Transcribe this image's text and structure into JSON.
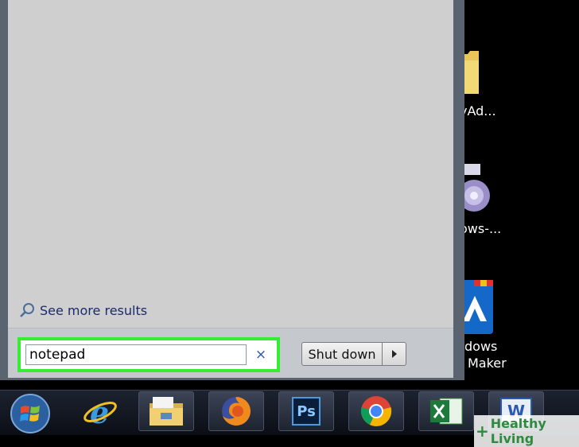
{
  "start_menu": {
    "see_more": "See more results",
    "search": {
      "value": "notepad",
      "clear": "×"
    },
    "shutdown": {
      "label": "Shut down"
    }
  },
  "desktop": {
    "icons": [
      {
        "name": "folder-shortcut",
        "label": "yAd..."
      },
      {
        "name": "disc-shortcut",
        "label": "ows-..."
      },
      {
        "name": "movie-maker-shortcut",
        "label": "dows",
        "label2": "Maker"
      }
    ]
  },
  "taskbar": {
    "apps": [
      "Internet Explorer",
      "Windows Explorer",
      "Firefox",
      "Photoshop",
      "Chrome",
      "Excel",
      "Word"
    ],
    "ps_text": "Ps",
    "word_text": "W"
  },
  "watermark": {
    "text": "Healthy Living",
    "symbol": "+"
  },
  "colors": {
    "highlight": "#33ee33",
    "menu_bg": "#cfcfcf",
    "taskbar": "#1d2230"
  }
}
